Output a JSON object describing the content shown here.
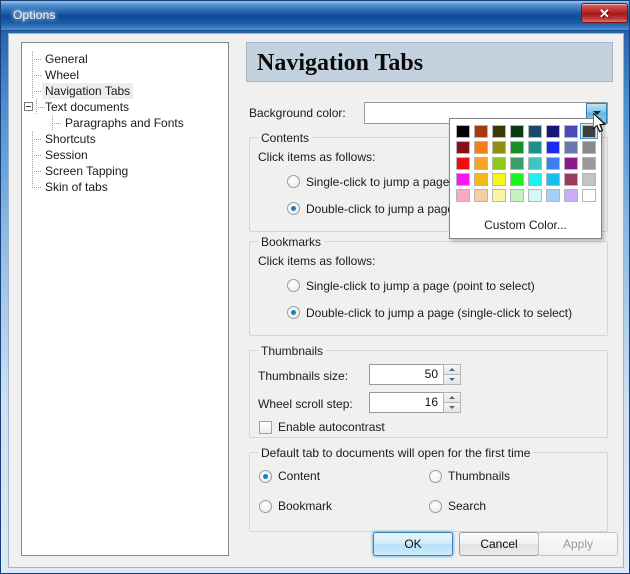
{
  "window": {
    "title": "Options",
    "close_label": "✕"
  },
  "sidebar": {
    "items": [
      {
        "label": "General",
        "level": 0,
        "selected": false,
        "expander": false
      },
      {
        "label": "Wheel",
        "level": 0,
        "selected": false,
        "expander": false
      },
      {
        "label": "Navigation Tabs",
        "level": 0,
        "selected": true,
        "expander": false
      },
      {
        "label": "Text documents",
        "level": 0,
        "selected": false,
        "expander": true
      },
      {
        "label": "Paragraphs and Fonts",
        "level": 1,
        "selected": false,
        "expander": false
      },
      {
        "label": "Shortcuts",
        "level": 0,
        "selected": false,
        "expander": false
      },
      {
        "label": "Session",
        "level": 0,
        "selected": false,
        "expander": false
      },
      {
        "label": "Screen Tapping",
        "level": 0,
        "selected": false,
        "expander": false
      },
      {
        "label": "Skin of tabs",
        "level": 0,
        "selected": false,
        "expander": false
      }
    ]
  },
  "page": {
    "title": "Navigation Tabs",
    "background_color": {
      "label": "Background color:",
      "value": "",
      "dropdown_icon": "chevron-down-icon"
    },
    "contents": {
      "title": "Contents",
      "instruction": "Click items as follows:",
      "options": [
        {
          "label": "Single-click to jump a page (point to select)",
          "selected": false
        },
        {
          "label": "Double-click to jump a page (single-click to select)",
          "selected": true
        }
      ]
    },
    "bookmarks": {
      "title": "Bookmarks",
      "instruction": "Click items as follows:",
      "options": [
        {
          "label": "Single-click to jump a page (point to select)",
          "selected": false
        },
        {
          "label": "Double-click to jump a page (single-click to select)",
          "selected": true
        }
      ]
    },
    "thumbnails": {
      "title": "Thumbnails",
      "size_label": "Thumbnails size:",
      "size_value": "50",
      "scroll_label": "Wheel scroll step:",
      "scroll_value": "16",
      "autocontrast_label": "Enable autocontrast",
      "autocontrast_checked": false
    },
    "default_tab": {
      "title": "Default tab to documents will open for the first time",
      "options": [
        {
          "label": "Content",
          "selected": true
        },
        {
          "label": "Thumbnails",
          "selected": false
        },
        {
          "label": "Bookmark",
          "selected": false
        },
        {
          "label": "Search",
          "selected": false
        }
      ]
    }
  },
  "color_popup": {
    "custom_label": "Custom Color...",
    "selected_index": 7,
    "rows": [
      [
        "#000000",
        "#a8380f",
        "#3a3a05",
        "#0a3a12",
        "#1b4a69",
        "#161678",
        "#4a4ab8",
        "#3d3d3d"
      ],
      [
        "#8a0f16",
        "#f57e1a",
        "#8f8f12",
        "#168f23",
        "#1d9090",
        "#1a2af0",
        "#6a77ae",
        "#8a8a8a"
      ],
      [
        "#f20d0d",
        "#f7a426",
        "#8fc71a",
        "#3c9e6a",
        "#3dc4c4",
        "#3c7df0",
        "#8a1a8a",
        "#9a9a9a"
      ],
      [
        "#f716f7",
        "#f5b91a",
        "#f7f51a",
        "#1df21d",
        "#1df2f2",
        "#19bdf0",
        "#9e3a5e",
        "#c4c4c4"
      ],
      [
        "#f9a8c6",
        "#f9cda1",
        "#fbf5a8",
        "#c6f0c4",
        "#d6f7f7",
        "#a8cdf7",
        "#ccacf7",
        "#ffffff"
      ]
    ]
  },
  "footer": {
    "ok_label": "OK",
    "cancel_label": "Cancel",
    "apply_label": "Apply",
    "apply_disabled": true
  }
}
